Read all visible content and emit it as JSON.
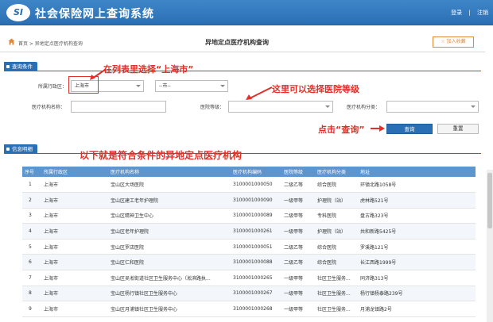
{
  "header": {
    "logo": "SI",
    "title": "社会保险网上查询系统",
    "links": [
      "登录",
      "注销"
    ]
  },
  "breadcrumb": {
    "text": "首页 > 异地定点医疗机构查询",
    "page_title": "异地定点医疗机构查询",
    "fav_button": "加入收藏"
  },
  "query_section": {
    "tag": "查询条件",
    "region_label": "所属行政区：",
    "region_value": "上海市",
    "district_value": "--市--",
    "name_label": "医疗机构名称：",
    "name_value": "",
    "level_label": "医院等级：",
    "level_value": "",
    "category_label": "医疗机构分类：",
    "category_value": "",
    "query_button": "查询",
    "reset_button": "重置"
  },
  "annotations": {
    "select_city": "在列表里选择“上海市”",
    "select_level": "这里可以选择医院等级",
    "click_query": "点击“查询”",
    "result_intro": "以下就是符合条件的异地定点医疗机构"
  },
  "result_section": {
    "tag": "信息明细",
    "columns": [
      "序号",
      "所属行政区",
      "医疗机构名称",
      "医疗机构编码",
      "医院等级",
      "医疗机构分类",
      "地址"
    ],
    "rows": [
      [
        "1",
        "上海市",
        "宝山区大场医院",
        "3100001000050",
        "二级乙等",
        "综合医院",
        "环镇北路1058号"
      ],
      [
        "2",
        "上海市",
        "宝山区建工老年护理院",
        "3100001000090",
        "一级甲等",
        "护理院（站）",
        "虎林路521号"
      ],
      [
        "3",
        "上海市",
        "宝山区精神卫生中心",
        "3100001000089",
        "二级甲等",
        "专科医院",
        "盘古路323号"
      ],
      [
        "4",
        "上海市",
        "宝山区老年护理院",
        "3100001000261",
        "一级甲等",
        "护理院（站）",
        "共和新路5425号"
      ],
      [
        "5",
        "上海市",
        "宝山区罗店医院",
        "3100001000051",
        "二级乙等",
        "综合医院",
        "罗溪路121号"
      ],
      [
        "6",
        "上海市",
        "宝山区仁和医院",
        "3100001000088",
        "二级乙等",
        "综合医院",
        "长江西路1999号"
      ],
      [
        "7",
        "上海市",
        "宝山区吴淞街道社区卫生服务中心（淞滨路执...",
        "3100001000265",
        "一级甲等",
        "社区卫生服务...",
        "同济路313号"
      ],
      [
        "8",
        "上海市",
        "宝山区杨行镇社区卫生服务中心",
        "3100001000267",
        "一级甲等",
        "社区卫生服务...",
        "杨行镇杨泰路239号"
      ],
      [
        "9",
        "上海市",
        "宝山区月浦镇社区卫生服务中心",
        "3100001000268",
        "一级甲等",
        "社区卫生服务...",
        "月浦龙镇路2号"
      ]
    ]
  },
  "colors": {
    "primary": "#2a6fb3",
    "annotation": "#e0302a",
    "table_header": "#5d95cf"
  }
}
